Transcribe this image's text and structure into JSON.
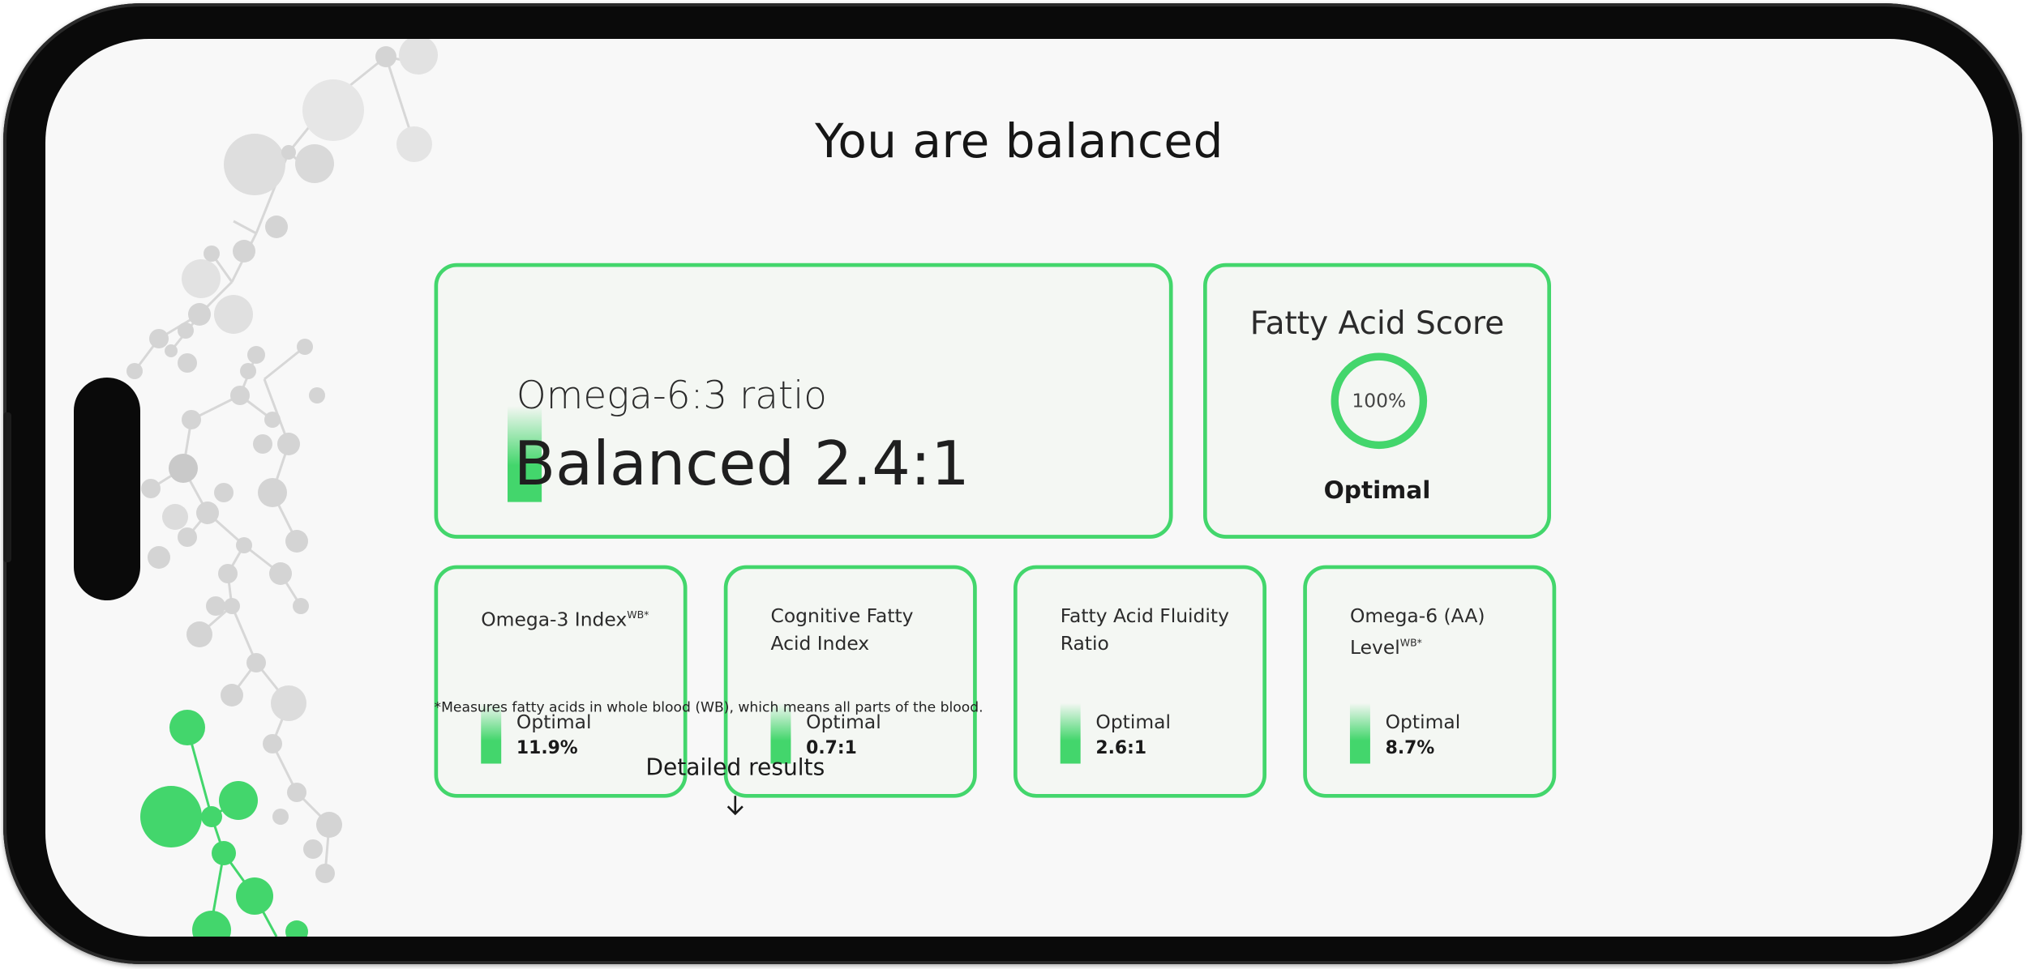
{
  "page": {
    "title": "You are balanced"
  },
  "ratio_card": {
    "label": "Omega-6:3 ratio",
    "value": "Balanced 2.4:1"
  },
  "score_card": {
    "label": "Fatty Acid Score",
    "percent": "100%",
    "level": 1.0,
    "status": "Optimal"
  },
  "metrics": [
    {
      "title": "Omega-3 Index",
      "sup": "WB*",
      "status": "Optimal",
      "value": "11.9%"
    },
    {
      "title": "Cognitive Fatty Acid Index",
      "sup": "",
      "status": "Optimal",
      "value": "0.7:1"
    },
    {
      "title": "Fatty Acid Fluidity Ratio",
      "sup": "",
      "status": "Optimal",
      "value": "2.6:1"
    },
    {
      "title": "Omega-6 (AA) Level",
      "sup": "WB*",
      "status": "Optimal",
      "value": "8.7%"
    }
  ],
  "footnote": "*Measures fatty acids in whole blood (WB), which means all parts of the blood.",
  "detailed_results": {
    "label": "Detailed results",
    "icon": "arrow-down-icon"
  },
  "colors": {
    "accent": "#43d66c",
    "card_bg": "#f4f7f3",
    "screen_bg": "#f8f8f8",
    "molecule_gray": "#d4d4d4"
  }
}
